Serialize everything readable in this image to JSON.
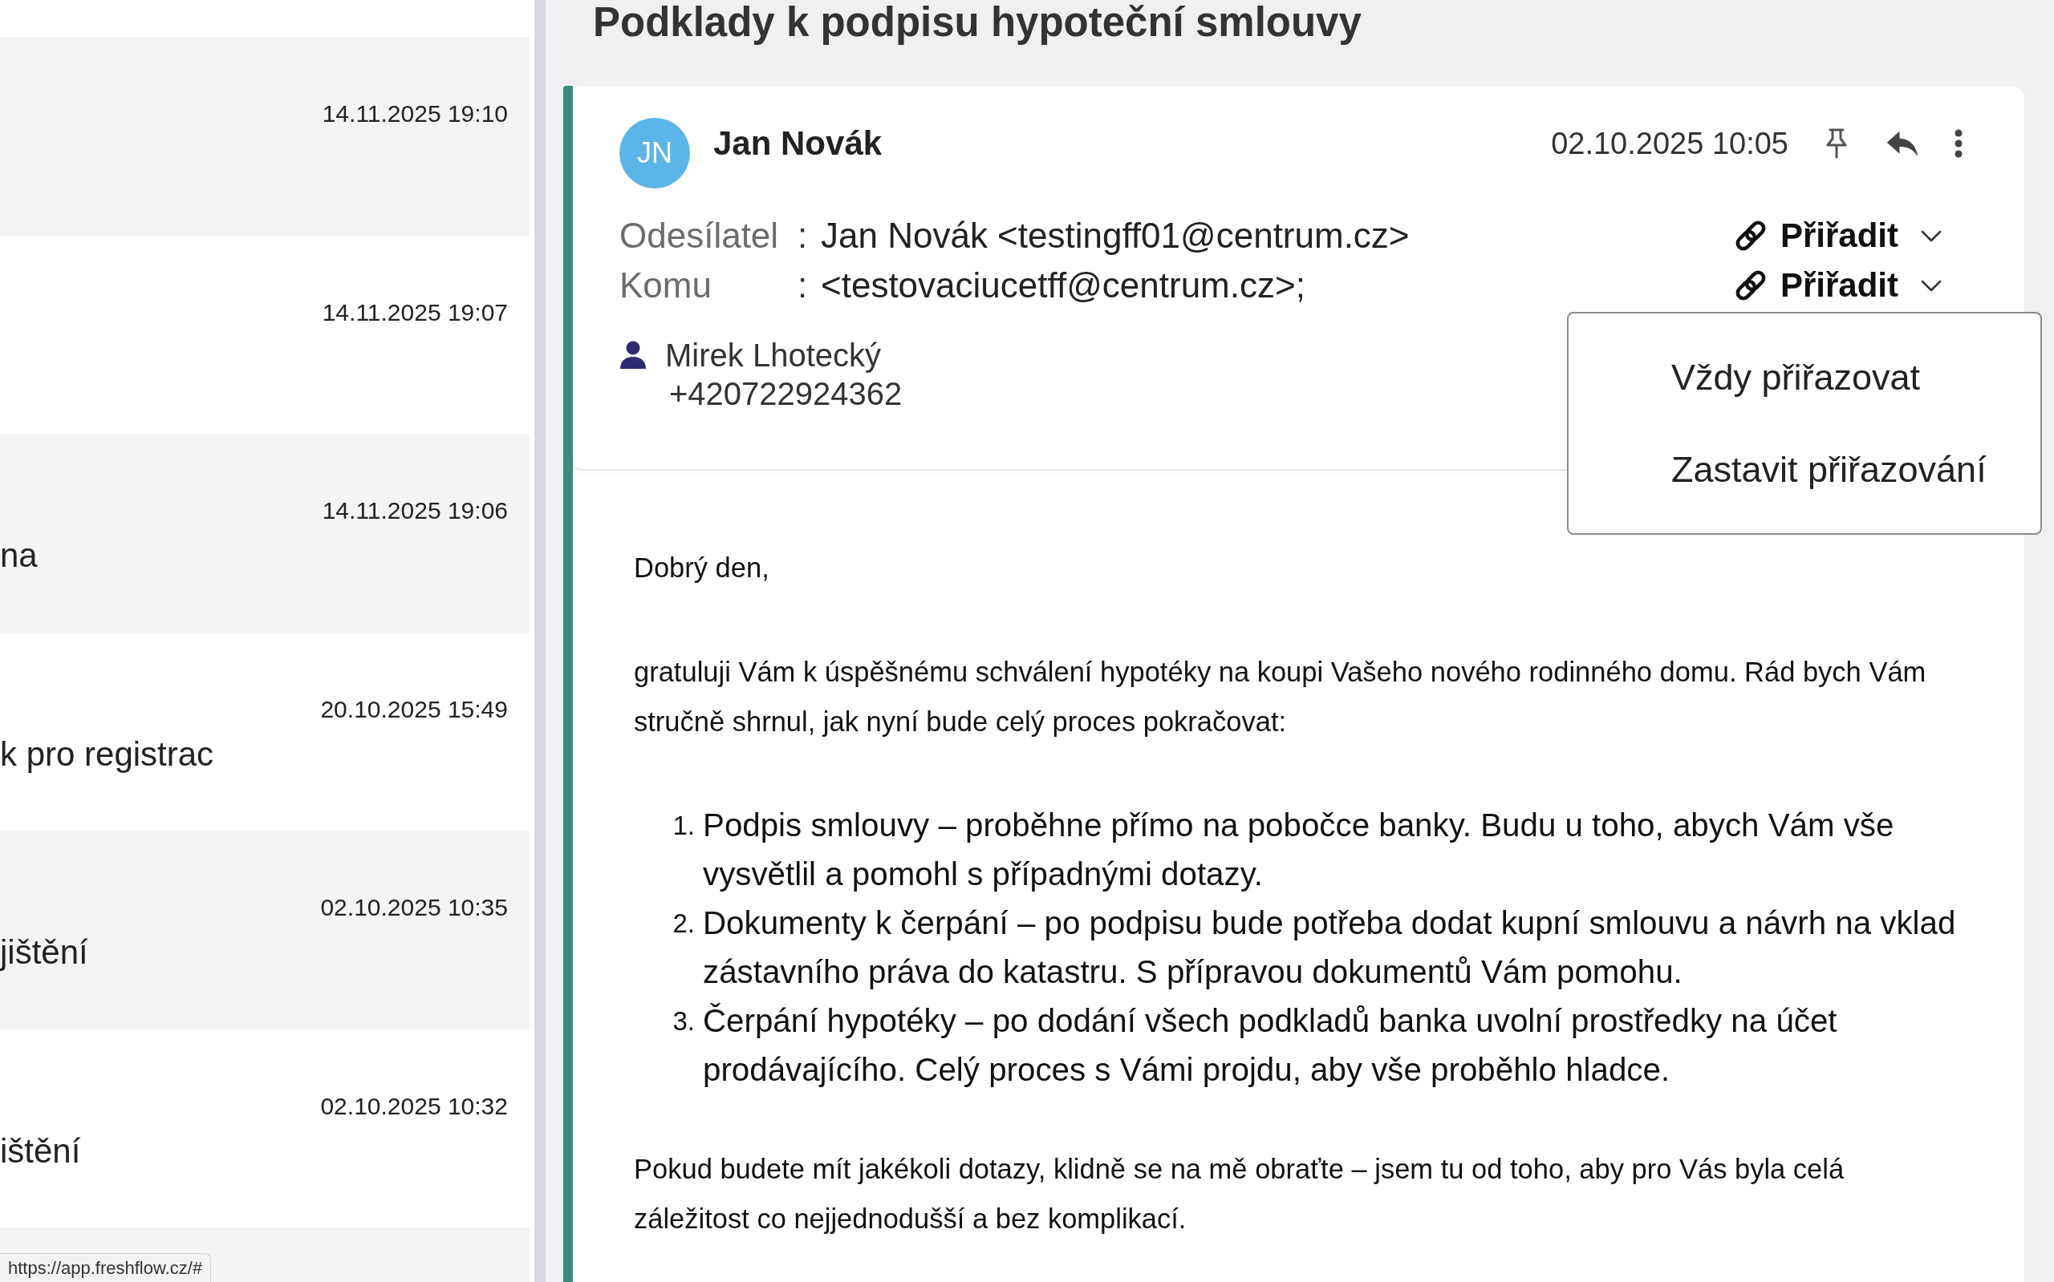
{
  "message_list": {
    "items": [
      {
        "date": "14.11.2025 19:10"
      },
      {
        "date": "14.11.2025 19:07"
      },
      {
        "date": "14.11.2025 19:06",
        "subject": "na"
      },
      {
        "date": "20.10.2025 15:49",
        "subject": "k pro registrac"
      },
      {
        "date": "02.10.2025 10:35",
        "subject": "jištění"
      },
      {
        "date": "02.10.2025 10:32",
        "subject": "ištění"
      }
    ]
  },
  "detail": {
    "title": "Podklady k podpisu hypoteční smlouvy",
    "message": {
      "avatar_initials": "JN",
      "sender": "Jan Novák",
      "date": "02.10.2025 10:05",
      "fields": [
        {
          "label": "Odesílatel",
          "separator": ":",
          "value": "Jan Novák <testingff01@centrum.cz>",
          "assign_label": "Přiřadit"
        },
        {
          "label": "Komu",
          "separator": ":",
          "value": "<testovaciucetff@centrum.cz>;",
          "assign_label": "Přiřadit",
          "menu": {
            "items": [
              "Vždy přiřazovat",
              "Zastavit přiřazování"
            ]
          }
        }
      ],
      "contact": {
        "name": "Mirek Lhotecký",
        "phone": "+420722924362"
      },
      "body": [
        {
          "kind": "paragraph",
          "text": "Dobrý den,"
        },
        {
          "kind": "paragraph",
          "text": "gratuluji Vám k úspěšnému schválení hypotéky na koupi Vašeho nového rodinného domu. Rád bych Vám stručně shrnul, jak nyní bude celý proces pokračovat:"
        },
        {
          "kind": "numbered_list",
          "items": [
            {
              "number": "1.",
              "text": "Podpis smlouvy – proběhne přímo na pobočce banky. Budu u toho, abych Vám vše vysvětlil a pomohl s případnými dotazy."
            },
            {
              "number": "2.",
              "text": "Dokumenty k čerpání – po podpisu bude potřeba dodat kupní smlouvu a návrh na vklad zástavního práva do katastru. S přípravou dokumentů Vám pomohu."
            },
            {
              "number": "3.",
              "text": "Čerpání hypotéky – po dodání všech podkladů banka uvolní prostředky na účet prodávajícího. Celý proces s Vámi projdu, aby vše proběhlo hladce."
            }
          ]
        },
        {
          "kind": "paragraph",
          "text": "Pokud budete mít jakékoli dotazy, klidně se na mě obraťte – jsem tu od toho, aby pro Vás byla celá záležitost co nejjednodušší a bez komplikací."
        }
      ]
    }
  },
  "status_bar": {
    "url": "https://app.freshflow.cz/#"
  }
}
